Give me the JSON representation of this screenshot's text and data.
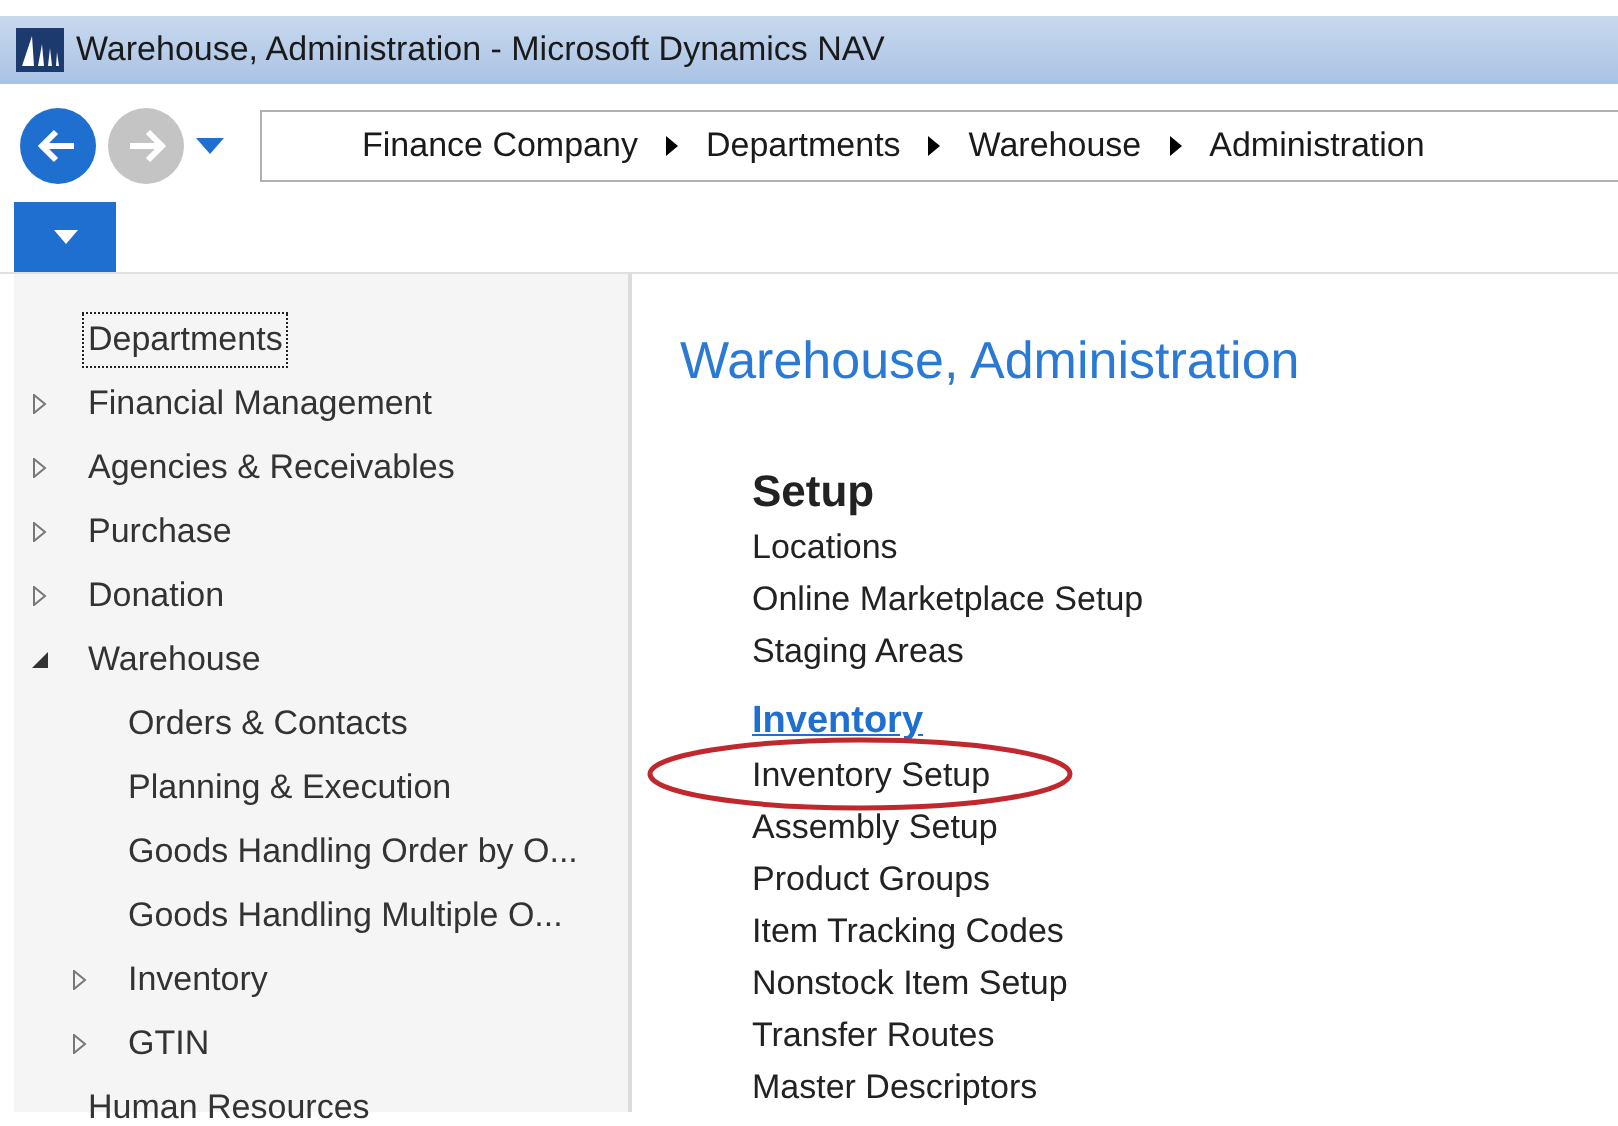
{
  "window": {
    "title": "Warehouse, Administration - Microsoft Dynamics NAV"
  },
  "navigation": {
    "back": {
      "disabled": false
    },
    "forward": {
      "disabled": true
    },
    "breadcrumb": [
      "Finance Company",
      "Departments",
      "Warehouse",
      "Administration"
    ]
  },
  "sidebar": {
    "items": [
      {
        "label": "Departments",
        "kind": "leaf",
        "selected": true
      },
      {
        "label": "Financial Management",
        "kind": "group",
        "expanded": false,
        "selected": false
      },
      {
        "label": "Agencies & Receivables",
        "kind": "group",
        "expanded": false,
        "selected": false
      },
      {
        "label": "Purchase",
        "kind": "group",
        "expanded": false,
        "selected": false
      },
      {
        "label": "Donation",
        "kind": "group",
        "expanded": false,
        "selected": false
      },
      {
        "label": "Warehouse",
        "kind": "group",
        "expanded": true,
        "selected": false,
        "children": [
          {
            "label": "Orders & Contacts",
            "kind": "leaf",
            "selected": false
          },
          {
            "label": "Planning & Execution",
            "kind": "leaf",
            "selected": false
          },
          {
            "label": "Goods Handling Order by O...",
            "kind": "leaf",
            "selected": false
          },
          {
            "label": "Goods Handling Multiple O...",
            "kind": "leaf",
            "selected": false
          },
          {
            "label": "Inventory",
            "kind": "group",
            "expanded": false,
            "selected": false
          },
          {
            "label": "GTIN",
            "kind": "group",
            "expanded": false,
            "selected": false
          }
        ]
      },
      {
        "label": "Human Resources",
        "kind": "leaf",
        "selected": false
      }
    ]
  },
  "page": {
    "title": "Warehouse, Administration",
    "sections": [
      {
        "heading": "Setup",
        "kind": "plain",
        "items": [
          {
            "label": "Locations",
            "highlighted": false
          },
          {
            "label": "Online Marketplace Setup",
            "highlighted": false
          },
          {
            "label": "Staging Areas",
            "highlighted": false
          }
        ]
      },
      {
        "heading": "Inventory",
        "kind": "link",
        "items": [
          {
            "label": "Inventory Setup",
            "highlighted": true
          },
          {
            "label": "Assembly Setup",
            "highlighted": false
          },
          {
            "label": "Product Groups",
            "highlighted": false
          },
          {
            "label": "Item Tracking Codes",
            "highlighted": false
          },
          {
            "label": "Nonstock Item Setup",
            "highlighted": false
          },
          {
            "label": "Transfer Routes",
            "highlighted": false
          },
          {
            "label": "Master Descriptors",
            "highlighted": false
          }
        ]
      }
    ]
  }
}
